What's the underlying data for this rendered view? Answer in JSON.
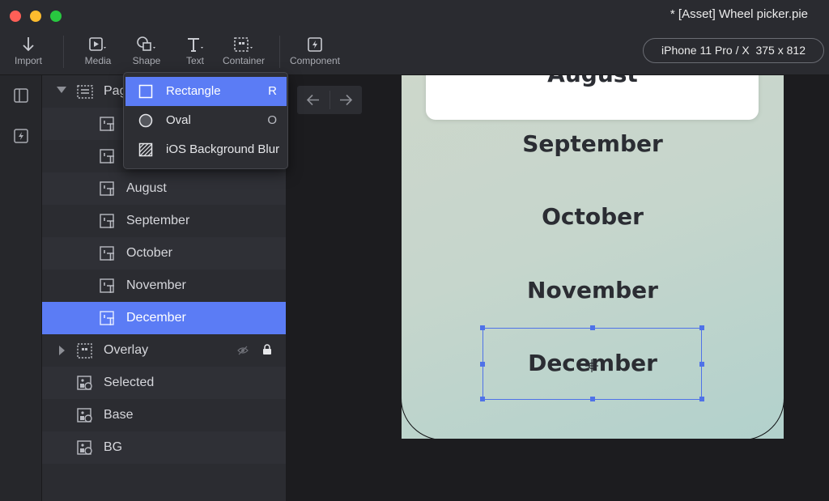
{
  "window": {
    "title": "* [Asset] Wheel picker.pie"
  },
  "toolbar": {
    "import_label": "Import",
    "media_label": "Media",
    "shape_label": "Shape",
    "text_label": "Text",
    "container_label": "Container",
    "component_label": "Component",
    "device_label": "iPhone 11 Pro / X  375 x 812"
  },
  "shape_menu": {
    "items": [
      {
        "label": "Rectangle",
        "shortcut": "R",
        "icon": "rectangle-icon",
        "active": true
      },
      {
        "label": "Oval",
        "shortcut": "O",
        "icon": "oval-icon"
      },
      {
        "label": "iOS Background Blur",
        "shortcut": "",
        "icon": "blur-icon"
      }
    ]
  },
  "layers": {
    "page_label": "Pag",
    "items": [
      {
        "label": "August",
        "icon": "text-layer-icon"
      },
      {
        "label": "September",
        "icon": "text-layer-icon"
      },
      {
        "label": "October",
        "icon": "text-layer-icon"
      },
      {
        "label": "November",
        "icon": "text-layer-icon"
      },
      {
        "label": "December",
        "icon": "text-layer-icon",
        "selected": true
      },
      {
        "label": "Overlay",
        "icon": "container-icon"
      },
      {
        "label": "Selected",
        "icon": "shape-layer-icon"
      },
      {
        "label": "Base",
        "icon": "shape-layer-icon"
      },
      {
        "label": "BG",
        "icon": "shape-layer-icon"
      }
    ]
  },
  "canvas": {
    "months": [
      "August",
      "September",
      "October",
      "November",
      "December"
    ]
  },
  "colors": {
    "accent": "#5b7cf5",
    "selection": "#4f72e8",
    "panel": "#2b2c31",
    "titlebar": "#2a2b30"
  }
}
